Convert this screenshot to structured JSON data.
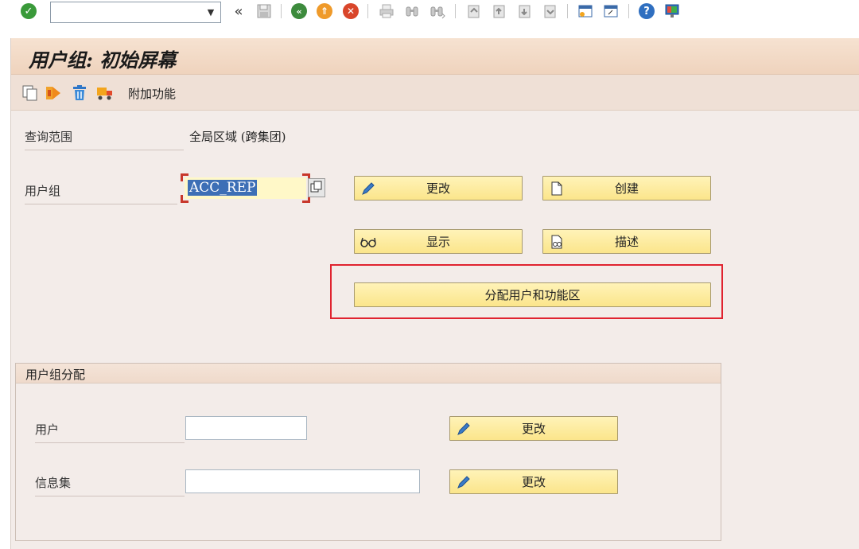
{
  "system_toolbar": {
    "command_field_value": "",
    "icons": [
      "enter-icon",
      "command-dropdown-icon",
      "collapse-icon",
      "save-icon",
      "back-icon",
      "exit-icon",
      "cancel-icon",
      "print-icon",
      "find-icon",
      "find-next-icon",
      "first-page-icon",
      "previous-page-icon",
      "next-page-icon",
      "last-page-icon",
      "create-session-icon",
      "shortcut-icon",
      "help-icon",
      "customize-layout-icon"
    ],
    "collapse_glyph": "«"
  },
  "screen": {
    "title": "用户组: 初始屏幕"
  },
  "app_toolbar": {
    "extra_label": "附加功能"
  },
  "form": {
    "query_scope_label": "查询范围",
    "query_scope_value": "全局区域 (跨集团)",
    "user_group_label": "用户组",
    "user_group_value": "ACC_REP"
  },
  "buttons": {
    "change_label": "更改",
    "create_label": "创建",
    "display_label": "显示",
    "describe_label": "描述",
    "assign_label": "分配用户和功能区"
  },
  "assignment": {
    "group_title": "用户组分配",
    "user_label": "用户",
    "user_value": "",
    "infoset_label": "信息集",
    "infoset_value": "",
    "user_change_label": "更改",
    "infoset_change_label": "更改"
  },
  "colors": {
    "button_yellow": "#fbe58b",
    "panel_bg": "#f3ece9",
    "title_bg": "#f6e2d1",
    "highlight_red": "#e0232f",
    "selection_blue": "#3d6fb6"
  }
}
